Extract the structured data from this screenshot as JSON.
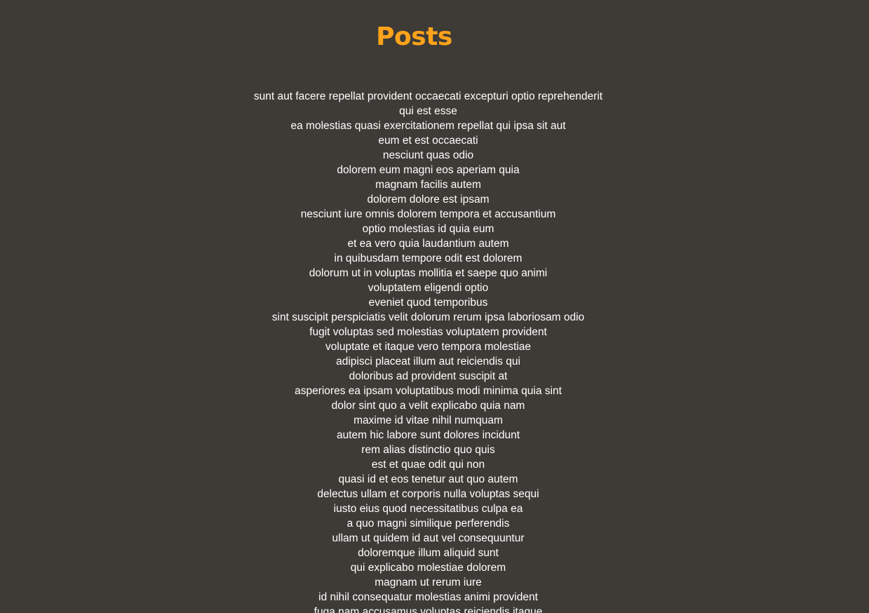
{
  "theme": {
    "background": "#3e3b37",
    "accent": "#ffa31a",
    "text": "#ffffff"
  },
  "header": {
    "title": "Posts"
  },
  "posts": [
    "sunt aut facere repellat provident occaecati excepturi optio reprehenderit",
    "qui est esse",
    "ea molestias quasi exercitationem repellat qui ipsa sit aut",
    "eum et est occaecati",
    "nesciunt quas odio",
    "dolorem eum magni eos aperiam quia",
    "magnam facilis autem",
    "dolorem dolore est ipsam",
    "nesciunt iure omnis dolorem tempora et accusantium",
    "optio molestias id quia eum",
    "et ea vero quia laudantium autem",
    "in quibusdam tempore odit est dolorem",
    "dolorum ut in voluptas mollitia et saepe quo animi",
    "voluptatem eligendi optio",
    "eveniet quod temporibus",
    "sint suscipit perspiciatis velit dolorum rerum ipsa laboriosam odio",
    "fugit voluptas sed molestias voluptatem provident",
    "voluptate et itaque vero tempora molestiae",
    "adipisci placeat illum aut reiciendis qui",
    "doloribus ad provident suscipit at",
    "asperiores ea ipsam voluptatibus modi minima quia sint",
    "dolor sint quo a velit explicabo quia nam",
    "maxime id vitae nihil numquam",
    "autem hic labore sunt dolores incidunt",
    "rem alias distinctio quo quis",
    "est et quae odit qui non",
    "quasi id et eos tenetur aut quo autem",
    "delectus ullam et corporis nulla voluptas sequi",
    "iusto eius quod necessitatibus culpa ea",
    "a quo magni similique perferendis",
    "ullam ut quidem id aut vel consequuntur",
    "doloremque illum aliquid sunt",
    "qui explicabo molestiae dolorem",
    "magnam ut rerum iure",
    "id nihil consequatur molestias animi provident",
    "fuga nam accusamus voluptas reiciendis itaque"
  ]
}
